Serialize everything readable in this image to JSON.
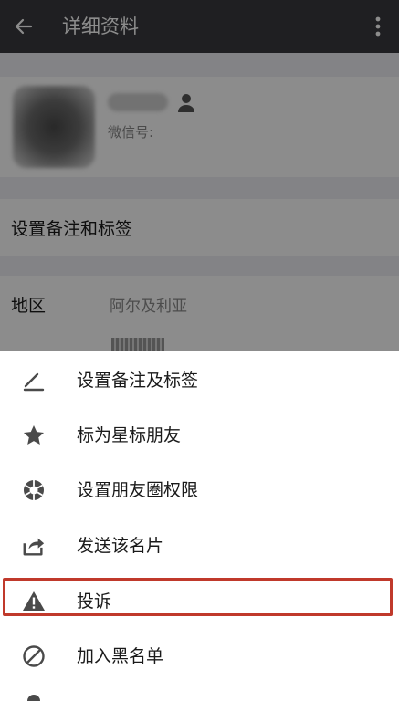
{
  "topbar": {
    "title": "详细资料",
    "back_icon": "arrow-left-icon",
    "more_icon": "more-vertical-icon"
  },
  "profile": {
    "wechat_id_label": "微信号:",
    "gender_icon": "person-icon"
  },
  "rows": {
    "remark_label": "设置备注和标签",
    "region_label": "地区",
    "region_value": "阿尔及利亚"
  },
  "menu": {
    "items": [
      {
        "label": "设置备注及标签",
        "icon": "pencil-icon"
      },
      {
        "label": "标为星标朋友",
        "icon": "star-icon"
      },
      {
        "label": "设置朋友圈权限",
        "icon": "aperture-icon"
      },
      {
        "label": "发送该名片",
        "icon": "share-icon"
      },
      {
        "label": "投诉",
        "icon": "warning-icon"
      },
      {
        "label": "加入黑名单",
        "icon": "block-icon"
      }
    ]
  },
  "colors": {
    "topbar_bg": "#393a3f",
    "highlight_border": "#c0392b",
    "icon_color": "#4a4a4a"
  }
}
